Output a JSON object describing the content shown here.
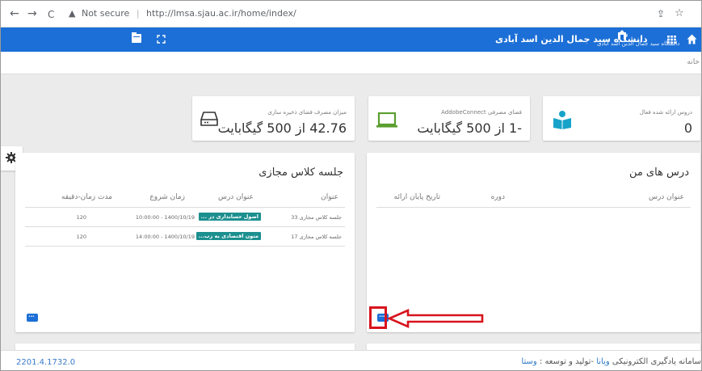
{
  "browser": {
    "back_icon": "←",
    "forward_icon": "→",
    "reload_icon": "C",
    "security_text": "Not secure",
    "url": "http://lmsa.sjau.ac.ir/home/index/",
    "share_icon": "⇪",
    "star_icon": "☆"
  },
  "header": {
    "university_name": "دانشگاه سید جمال الدین اسد آبادی",
    "logo_subtext": "دانشگاه سید جمال الدین اسد آبادی",
    "accent_color": "#1c6fd6"
  },
  "breadcrumb": {
    "text": "خانه"
  },
  "stats": {
    "storage": {
      "label": "میزان مصرف فضای ذخیره سازی",
      "value": "42.76 از 500 گیگابایت",
      "icon": "hard-drive-icon"
    },
    "adobe": {
      "label": "فضای مصرفی AddobeConnect",
      "value": "-1 از 500 گیگابایت",
      "icon": "laptop-icon"
    },
    "courses": {
      "label": "دروس ارائه شده فعال",
      "value": "0",
      "icon": "book-reader-icon"
    }
  },
  "virtual_sessions": {
    "title": "جلسه کلاس مجازی",
    "columns": [
      "عنوان",
      "عنوان درس",
      "زمان شروع",
      "مدت زمان-دقیقه"
    ],
    "rows": [
      {
        "title": "جلسه کلاس مجازی 33",
        "course": "اصول حسابداری در ...",
        "start": "10:00:00 - 1400/10/19",
        "duration": "120"
      },
      {
        "title": "جلسه کلاس مجازی 17",
        "course": "متون اقتصادی به زب...",
        "start": "14:00:00 - 1400/10/19",
        "duration": "120"
      }
    ]
  },
  "my_courses": {
    "title": "درس های من",
    "columns": [
      "عنوان درس",
      "دوره",
      "تاریخ پایان ارائه"
    ]
  },
  "footer": {
    "version": "2201.4.1732.0",
    "credit_prefix": "سامانه یادگیری الکترونیکی",
    "credit_brand1": "ویانا",
    "credit_mid": "-تولید و توسعه :",
    "credit_brand2": "وستا"
  },
  "annotation": {
    "color": "#d8141d"
  }
}
